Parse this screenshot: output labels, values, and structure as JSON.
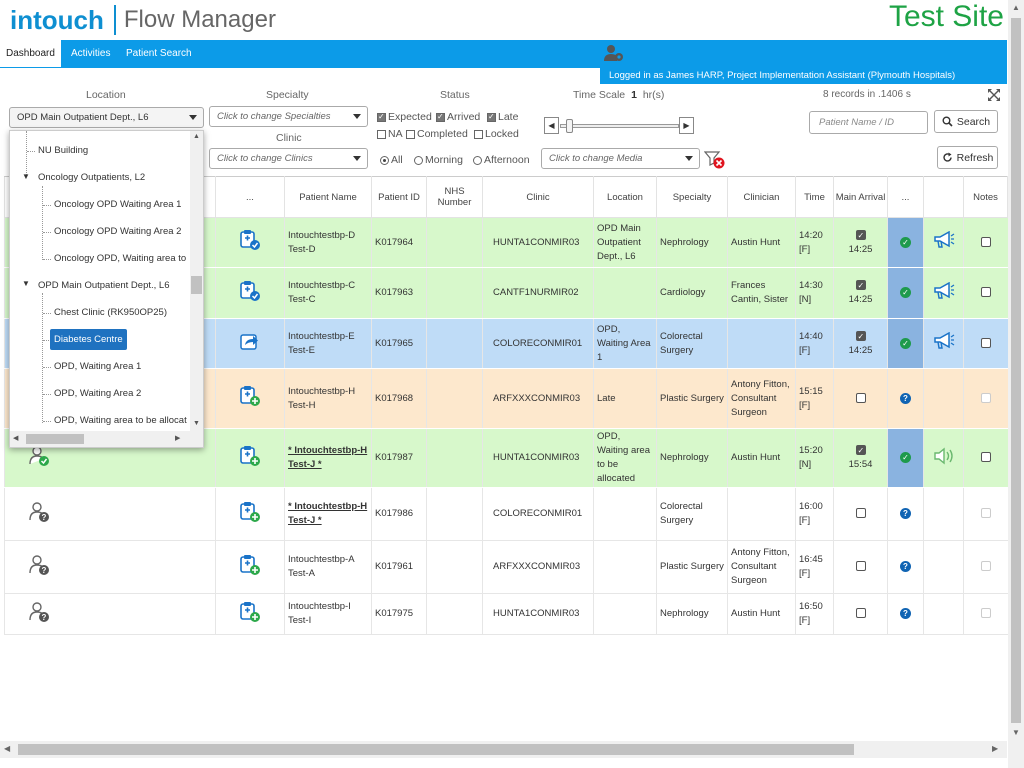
{
  "header": {
    "logo": "intouch",
    "product": "Flow Manager",
    "site": "Test Site"
  },
  "tabs": [
    "Dashboard",
    "Activities",
    "Patient Search"
  ],
  "user": "Logged in as James HARP, Project Implementation Assistant (Plymouth Hospitals)",
  "filters": {
    "location_label": "Location",
    "location_value": "OPD Main Outpatient Dept., L6",
    "specialty_label": "Specialty",
    "specialty_placeholder": "Click to change Specialties",
    "clinic_label": "Clinic",
    "clinic_placeholder": "Click to change Clinics",
    "status_label": "Status",
    "status": [
      "Expected",
      "Arrived",
      "Late",
      "NA",
      "Completed",
      "Locked"
    ],
    "timescale_label": "Time Scale",
    "timescale_value": "1",
    "timescale_unit": "hr(s)",
    "records": "8 records in .1406 s",
    "period": [
      "All",
      "Morning",
      "Afternoon"
    ],
    "media_placeholder": "Click to change Media",
    "search_placeholder": "Patient Name / ID",
    "search_button": "Search",
    "refresh_button": "Refresh"
  },
  "dropdown": {
    "items": [
      "NU Building",
      "Oncology Outpatients, L2",
      "Oncology OPD Waiting Area 1",
      "Oncology OPD Waiting Area 2",
      "Oncology OPD, Waiting area to",
      "OPD Main Outpatient Dept., L6",
      "Chest Clinic (RK950OP25)",
      "Diabetes Centre",
      "OPD, Waiting Area 1",
      "OPD, Waiting Area 2",
      "OPD, Waiting area to be allocat"
    ]
  },
  "columns": [
    "...",
    "Patient Name",
    "Patient ID",
    "NHS Number",
    "Clinic",
    "Location",
    "Specialty",
    "Clinician",
    "Time",
    "Main Arrival",
    "...",
    "Notes"
  ],
  "rows": [
    {
      "name": "Intouchtestbp-D Test-D",
      "id": "K017964",
      "nhs": "",
      "clinic": "HUNTA1CONMIR03",
      "location": "OPD Main Outpatient Dept., L6",
      "specialty": "Nephrology",
      "clinician": "Austin Hunt",
      "time": "14:20 [F]",
      "arrival": "14:25"
    },
    {
      "name": "Intouchtestbp-C Test-C",
      "id": "K017963",
      "nhs": "",
      "clinic": "CANTF1NURMIR02",
      "location": "",
      "specialty": "Cardiology",
      "clinician": "Frances Cantin, Sister",
      "time": "14:30 [N]",
      "arrival": "14:25"
    },
    {
      "name": "Intouchtestbp-E Test-E",
      "id": "K017965",
      "nhs": "",
      "clinic": "COLORECONMIR01",
      "location": "OPD, Waiting Area 1",
      "specialty": "Colorectal Surgery",
      "clinician": "",
      "time": "14:40 [F]",
      "arrival": "14:25"
    },
    {
      "name": "Intouchtestbp-H Test-H",
      "id": "K017968",
      "nhs": "",
      "clinic": "ARFXXXCONMIR03",
      "location": "Late",
      "specialty": "Plastic Surgery",
      "clinician": "Antony Fitton, Consultant Surgeon",
      "time": "15:15 [F]",
      "arrival": ""
    },
    {
      "name": "* Intouchtestbp-H Test-J *",
      "id": "K017987",
      "nhs": "",
      "clinic": "HUNTA1CONMIR03",
      "location": "OPD, Waiting area to be allocated",
      "specialty": "Nephrology",
      "clinician": "Austin Hunt",
      "time": "15:20 [N]",
      "arrival": "15:54"
    },
    {
      "name": "* Intouchtestbp-H Test-J *",
      "id": "K017986",
      "nhs": "",
      "clinic": "COLORECONMIR01",
      "location": "",
      "specialty": "Colorectal Surgery",
      "clinician": "",
      "time": "16:00 [F]",
      "arrival": ""
    },
    {
      "name": "Intouchtestbp-A Test-A",
      "id": "K017961",
      "nhs": "",
      "clinic": "ARFXXXCONMIR03",
      "location": "",
      "specialty": "Plastic Surgery",
      "clinician": "Antony Fitton, Consultant Surgeon",
      "time": "16:45 [F]",
      "arrival": ""
    },
    {
      "name": "Intouchtestbp-I Test-I",
      "id": "K017975",
      "nhs": "",
      "clinic": "HUNTA1CONMIR03",
      "location": "",
      "specialty": "Nephrology",
      "clinician": "Austin Hunt",
      "time": "16:50 [F]",
      "arrival": ""
    }
  ]
}
